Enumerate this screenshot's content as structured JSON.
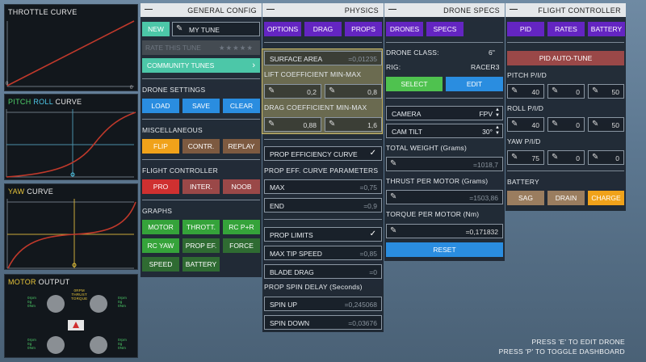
{
  "graphs": {
    "throttle": {
      "title": "THROTTLE CURVE",
      "zero_left": "0",
      "zero_right": "0"
    },
    "pitch_roll": {
      "t1": "PITCH",
      "t2": "ROLL",
      "t3": "CURVE",
      "marker": "0"
    },
    "yaw": {
      "t1": "YAW",
      "t2": "CURVE",
      "marker": "0"
    },
    "motor": {
      "t1": "MOTOR",
      "t2": "OUTPUT",
      "center_top": "0RPM",
      "center_mid": "THRUST",
      "center_bot": "TORQUE",
      "m1": [
        "0rpm",
        "0g",
        "0Nm"
      ],
      "m2": [
        "0rpm",
        "0g",
        "0Nm"
      ],
      "m3": [
        "0rpm",
        "0g",
        "0Nm"
      ],
      "m4": [
        "0rpm",
        "0g",
        "0Nm"
      ]
    }
  },
  "general": {
    "title": "GENERAL CONFIG",
    "new": "NEW",
    "tune_name": "MY TUNE",
    "rate_label": "RATE THIS TUNE",
    "community": "COMMUNITY TUNES",
    "drone_settings": "DRONE SETTINGS",
    "load": "LOAD",
    "save": "SAVE",
    "clear": "CLEAR",
    "misc": "MISCELLANEOUS",
    "flip": "FLIP",
    "contr": "CONTR.",
    "replay": "REPLAY",
    "fc": "FLIGHT CONTROLLER",
    "pro": "PRO",
    "inter": "INTER.",
    "noob": "NOOB",
    "graphs": "GRAPHS",
    "motor": "MOTOR",
    "thrott": "THROTT.",
    "rcpr": "RC P+R",
    "rcyaw": "RC YAW",
    "propef": "PROP EF.",
    "force": "FORCE",
    "speed": "SPEED",
    "battery": "BATTERY"
  },
  "physics": {
    "title": "PHYSICS",
    "tabs": [
      "OPTIONS",
      "DRAG",
      "PROPS"
    ],
    "surface_area": "SURFACE AREA",
    "surface_val": "=0,01235",
    "lift": "LIFT COEFFICIENT MIN-MAX",
    "lift_min": "0,2",
    "lift_max": "0,8",
    "drag": "DRAG COEFFICIENT MIN-MAX",
    "drag_min": "0,88",
    "drag_max": "1,6",
    "prop_eff_curve": "PROP EFFICIENCY CURVE",
    "prop_eff_params": "PROP EFF. CURVE PARAMETERS",
    "max": "MAX",
    "max_val": "=0,75",
    "end": "END",
    "end_val": "=0,9",
    "prop_limits": "PROP LIMITS",
    "max_tip": "MAX TIP SPEED",
    "max_tip_val": "=0,85",
    "blade_drag": "BLADE DRAG",
    "blade_drag_val": "=0",
    "spin_delay": "PROP SPIN DELAY (Seconds)",
    "spin_up": "SPIN UP",
    "spin_up_val": "=0,245068",
    "spin_down": "SPIN DOWN",
    "spin_down_val": "=0,03676"
  },
  "drone": {
    "title": "DRONE SPECS",
    "tabs": [
      "DRONES",
      "SPECS"
    ],
    "class_label": "DRONE CLASS:",
    "class_val": "6\"",
    "rig_label": "RIG:",
    "rig_val": "RACER3",
    "select": "SELECT",
    "edit": "EDIT",
    "camera": "CAMERA",
    "camera_val": "FPV",
    "camtilt": "CAM TILT",
    "camtilt_val": "30°",
    "weight": "TOTAL WEIGHT (Grams)",
    "weight_val": "=1018,7",
    "thrust": "THRUST PER MOTOR (Grams)",
    "thrust_val": "=1503,86",
    "torque": "TORQUE PER MOTOR (Nm)",
    "torque_val": "=0,171832",
    "reset": "RESET"
  },
  "fc": {
    "title": "FLIGHT CONTROLLER",
    "tabs": [
      "PID",
      "RATES",
      "BATTERY"
    ],
    "autotune": "PID AUTO-TUNE",
    "pitch": "PITCH P/I/D",
    "pitch_vals": [
      "40",
      "0",
      "50"
    ],
    "roll": "ROLL P/I/D",
    "roll_vals": [
      "40",
      "0",
      "50"
    ],
    "yaw": "YAW P/I/D",
    "yaw_vals": [
      "75",
      "0",
      "0"
    ],
    "battery": "BATTERY",
    "sag": "SAG",
    "drain": "DRAIN",
    "charge": "CHARGE"
  },
  "footer": {
    "line1": "PRESS 'E' TO EDIT DRONE",
    "line2": "PRESS 'P' TO TOGGLE DASHBOARD"
  },
  "colors": {
    "green": "#4fc24f",
    "blue": "#2a8de0",
    "purple": "#6425c2",
    "orange": "#f0a21a",
    "red": "#cf3030",
    "curve": "#c0392b"
  },
  "icons": {
    "minus": "minus-icon",
    "pen": "pencil-icon",
    "check": "check-icon",
    "chevron": "chevron-right-icon",
    "stars": "star-icon"
  }
}
